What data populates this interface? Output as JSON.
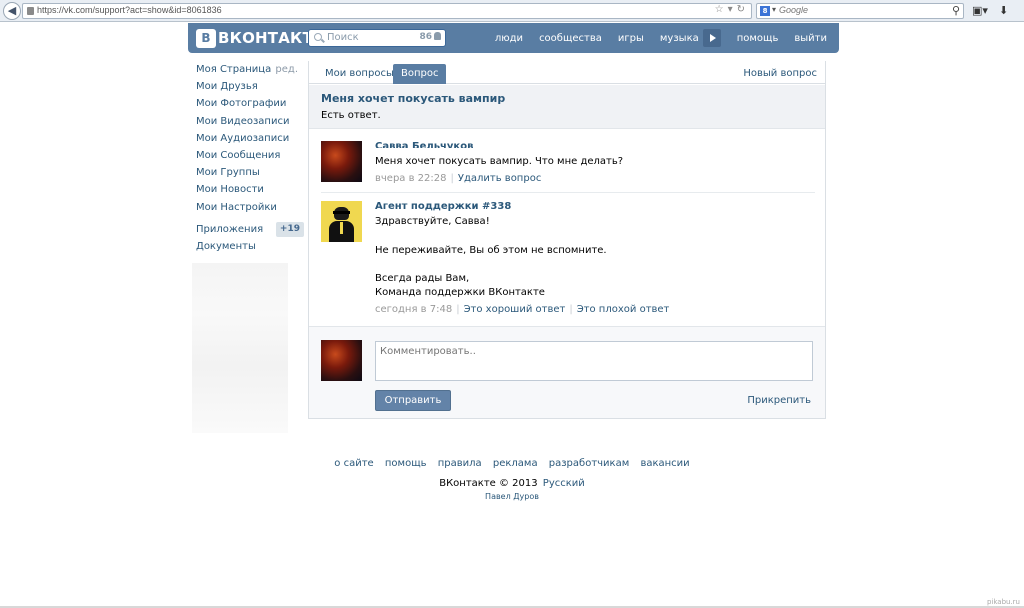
{
  "browser": {
    "url": "https://vk.com/support?act=show&id=8061836",
    "search_engine_placeholder": "Google"
  },
  "header": {
    "logo_text": "ВКОНТАКТЕ",
    "logo_mark": "В",
    "search_placeholder": "Поиск",
    "online_count": "86",
    "nav": [
      "люди",
      "сообщества",
      "игры",
      "музыка",
      "помощь",
      "выйти"
    ]
  },
  "menu": {
    "items": [
      "Моя Страница",
      "Мои Друзья",
      "Мои Фотографии",
      "Мои Видеозаписи",
      "Мои Аудиозаписи",
      "Мои Сообщения",
      "Мои Группы",
      "Мои Новости",
      "Мои Настройки"
    ],
    "edit_label": "ред.",
    "apps_label": "Приложения",
    "apps_badge": "+19",
    "docs_label": "Документы"
  },
  "tabs": {
    "my_questions": "Мои вопросы",
    "question": "Вопрос",
    "new_question": "Новый вопрос"
  },
  "question": {
    "title": "Меня хочет покусать вампир",
    "status": "Есть ответ."
  },
  "posts": [
    {
      "author": "Савва Бельчуков",
      "text": "Меня хочет покусать вампир. Что мне делать?",
      "time": "вчера в 22:28",
      "action": "Удалить вопрос"
    },
    {
      "author": "Агент поддержки #338",
      "greeting": "Здравствуйте, Савва!",
      "body": "Не переживайте, Вы об этом не вспомните.",
      "sign_line1": "Всегда рады Вам,",
      "sign_line2": "Команда поддержки ВКонтакте",
      "time": "сегодня в 7:48",
      "good_answer": "Это хороший ответ",
      "bad_answer": "Это плохой ответ"
    }
  ],
  "comment": {
    "placeholder": "Комментировать..",
    "send_label": "Отправить",
    "attach_label": "Прикрепить"
  },
  "footer": {
    "links": [
      "о сайте",
      "помощь",
      "правила",
      "реклама",
      "разработчикам",
      "вакансии"
    ],
    "copyright": "ВКонтакте © 2013",
    "language": "Русский",
    "author": "Павел Дуров"
  },
  "watermark": "pikabu.ru",
  "colors": {
    "header": "#597da3",
    "link": "#2b587a",
    "button": "#6383a8"
  }
}
